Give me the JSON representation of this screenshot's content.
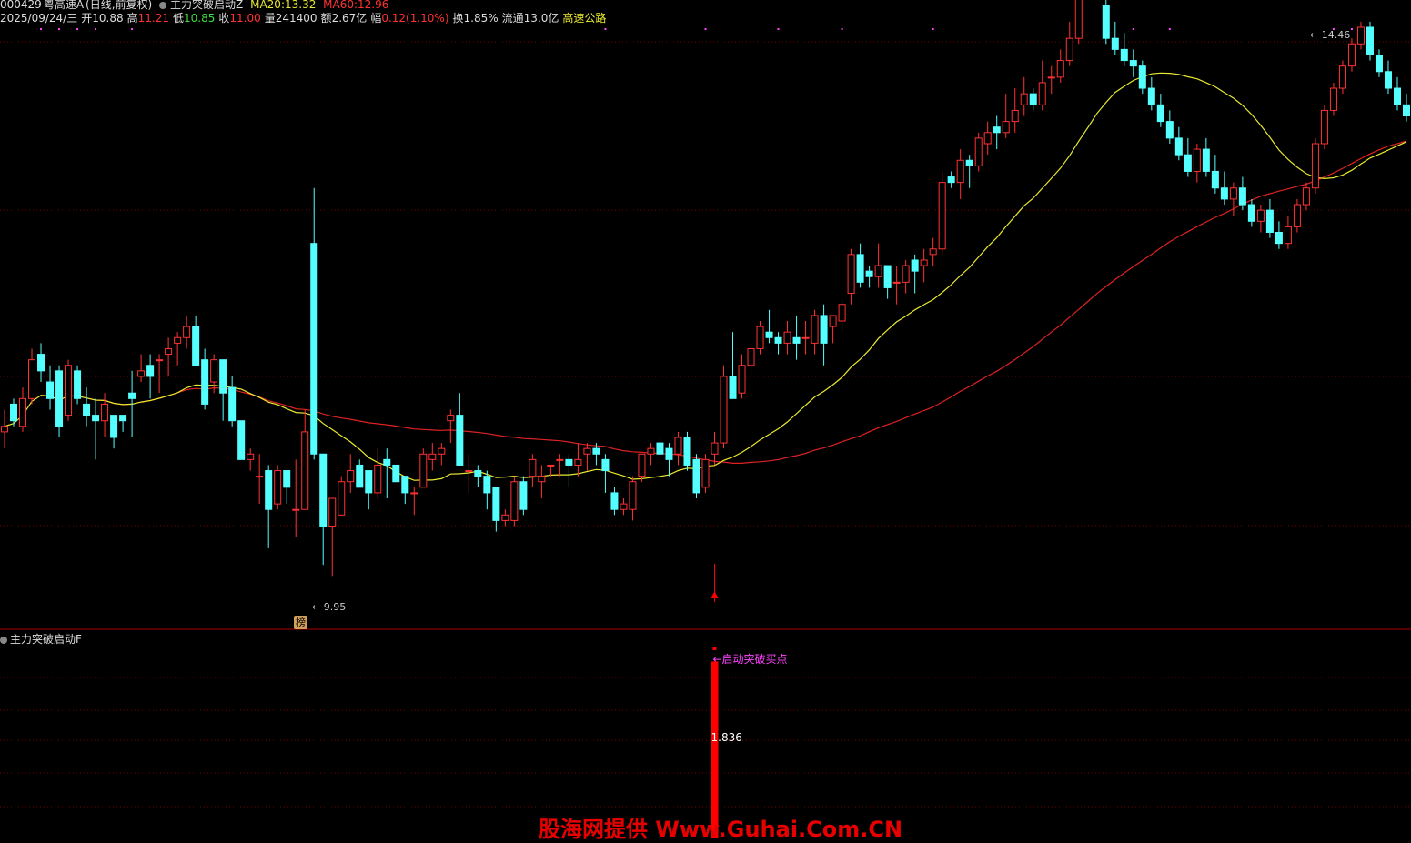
{
  "header": {
    "code": "000429",
    "name": "粤高速A",
    "period": "(日线,前复权)",
    "indicator_main": "主力突破启动Z",
    "ma20_label": "MA20:",
    "ma20_value": "13.32",
    "ma60_label": "MA60:",
    "ma60_value": "12.96",
    "date": "2025/09/24/三",
    "open_label": "开",
    "open": "10.88",
    "high_label": "高",
    "high": "11.21",
    "low_label": "低",
    "low": "10.85",
    "close_label": "收",
    "close": "11.00",
    "vol_label": "量",
    "vol": "241400",
    "amt_label": "额",
    "amt": "2.67亿",
    "chg_label": "幅",
    "chg": "0.12(1.10%)",
    "turnover_label": "换",
    "turnover": "1.85%",
    "float_label": "流通",
    "float_cap": "13.0亿",
    "sector": "高速公路"
  },
  "indicator_panel": {
    "title": "主力突破启动F",
    "signal_label": "←启动突破买点",
    "value_label": "1.836",
    "value": 1.836
  },
  "annotations": {
    "high_label": "14.46",
    "low_label": "9.95",
    "badge": "榜"
  },
  "watermark": "股海网提供 Www.Guhai.Com.CN",
  "colors": {
    "up": "#ff3232",
    "down": "#54ffff",
    "ma20": "#e8e832",
    "ma60": "#dd2222",
    "grid": "#7a0000",
    "signal": "#ff0000"
  },
  "chart_data": {
    "type": "candlestick",
    "price_range": [
      9.6,
      14.9
    ],
    "signal_index": 78,
    "candles": [
      [
        11.25,
        11.45,
        11.1,
        11.3
      ],
      [
        11.5,
        11.55,
        11.3,
        11.35
      ],
      [
        11.3,
        11.65,
        11.25,
        11.55
      ],
      [
        11.55,
        12.0,
        11.5,
        11.9
      ],
      [
        11.95,
        12.05,
        11.7,
        11.8
      ],
      [
        11.7,
        11.85,
        11.45,
        11.55
      ],
      [
        11.8,
        11.85,
        11.2,
        11.3
      ],
      [
        11.4,
        11.9,
        11.35,
        11.85
      ],
      [
        11.8,
        11.85,
        11.5,
        11.55
      ],
      [
        11.5,
        11.65,
        11.3,
        11.4
      ],
      [
        11.4,
        11.55,
        11.0,
        11.35
      ],
      [
        11.35,
        11.6,
        11.2,
        11.5
      ],
      [
        11.4,
        11.4,
        11.1,
        11.2
      ],
      [
        11.4,
        11.4,
        11.25,
        11.35
      ],
      [
        11.6,
        11.8,
        11.2,
        11.55
      ],
      [
        11.75,
        11.95,
        11.7,
        11.8
      ],
      [
        11.85,
        11.95,
        11.55,
        11.75
      ],
      [
        11.9,
        11.95,
        11.6,
        11.9
      ],
      [
        11.95,
        12.1,
        11.75,
        12.0
      ],
      [
        12.05,
        12.15,
        11.85,
        12.1
      ],
      [
        12.1,
        12.3,
        12.0,
        12.2
      ],
      [
        12.2,
        12.3,
        11.9,
        11.85
      ],
      [
        11.9,
        12.0,
        11.45,
        11.5
      ],
      [
        11.7,
        11.95,
        11.6,
        11.9
      ],
      [
        11.9,
        11.9,
        11.35,
        11.6
      ],
      [
        11.65,
        11.75,
        11.3,
        11.35
      ],
      [
        11.35,
        11.35,
        11.0,
        11.0
      ],
      [
        11.0,
        11.1,
        10.9,
        11.05
      ],
      [
        10.85,
        11.05,
        10.6,
        10.85
      ],
      [
        10.9,
        10.95,
        10.2,
        10.55
      ],
      [
        10.6,
        10.95,
        10.55,
        10.9
      ],
      [
        10.9,
        10.9,
        10.6,
        10.75
      ],
      [
        10.55,
        11.0,
        10.3,
        10.55
      ],
      [
        10.55,
        11.45,
        10.55,
        11.25
      ],
      [
        12.95,
        13.45,
        11.0,
        11.05
      ],
      [
        11.05,
        11.05,
        10.05,
        10.4
      ],
      [
        10.4,
        10.65,
        9.95,
        10.65
      ],
      [
        10.5,
        10.85,
        10.5,
        10.8
      ],
      [
        10.8,
        11.05,
        10.7,
        10.9
      ],
      [
        10.95,
        11.0,
        10.75,
        10.75
      ],
      [
        10.9,
        10.9,
        10.55,
        10.7
      ],
      [
        10.7,
        11.1,
        10.65,
        10.95
      ],
      [
        11.0,
        11.1,
        10.65,
        10.95
      ],
      [
        10.95,
        10.95,
        10.85,
        10.8
      ],
      [
        10.85,
        10.85,
        10.6,
        10.7
      ],
      [
        10.7,
        10.75,
        10.5,
        10.7
      ],
      [
        10.75,
        11.1,
        10.75,
        11.05
      ],
      [
        11.0,
        11.15,
        10.9,
        11.05
      ],
      [
        11.05,
        11.15,
        10.95,
        11.1
      ],
      [
        11.35,
        11.45,
        11.15,
        11.4
      ],
      [
        11.4,
        11.6,
        11.1,
        10.95
      ],
      [
        10.9,
        11.05,
        10.7,
        10.9
      ],
      [
        10.9,
        10.95,
        10.75,
        10.85
      ],
      [
        10.85,
        10.9,
        10.55,
        10.7
      ],
      [
        10.75,
        10.75,
        10.35,
        10.45
      ],
      [
        10.45,
        10.55,
        10.4,
        10.5
      ],
      [
        10.45,
        10.85,
        10.4,
        10.8
      ],
      [
        10.8,
        10.85,
        10.5,
        10.55
      ],
      [
        10.85,
        11.05,
        10.75,
        11.0
      ],
      [
        10.8,
        10.95,
        10.65,
        10.85
      ],
      [
        10.95,
        10.95,
        10.85,
        10.95
      ],
      [
        11.0,
        11.05,
        10.85,
        11.0
      ],
      [
        11.0,
        11.05,
        10.75,
        10.95
      ],
      [
        10.95,
        11.15,
        10.85,
        11.0
      ],
      [
        11.05,
        11.15,
        10.9,
        11.1
      ],
      [
        11.1,
        11.15,
        10.95,
        11.05
      ],
      [
        11.0,
        11.05,
        10.7,
        10.9
      ],
      [
        10.7,
        10.75,
        10.5,
        10.55
      ],
      [
        10.55,
        10.65,
        10.5,
        10.6
      ],
      [
        10.55,
        10.85,
        10.45,
        10.8
      ],
      [
        10.85,
        11.05,
        10.8,
        11.05
      ],
      [
        11.05,
        11.15,
        10.95,
        11.1
      ],
      [
        11.15,
        11.2,
        11.0,
        11.05
      ],
      [
        11.1,
        11.15,
        10.85,
        11.0
      ],
      [
        11.05,
        11.25,
        10.95,
        11.2
      ],
      [
        11.2,
        11.25,
        10.9,
        10.95
      ],
      [
        11.0,
        11.05,
        10.65,
        10.7
      ],
      [
        10.75,
        11.05,
        10.7,
        11.0
      ],
      [
        11.05,
        11.25,
        10.95,
        11.15
      ],
      [
        11.15,
        11.85,
        11.1,
        11.75
      ],
      [
        11.75,
        12.15,
        11.6,
        11.55
      ],
      [
        11.6,
        11.95,
        11.55,
        11.85
      ],
      [
        11.85,
        12.05,
        11.75,
        12.0
      ],
      [
        12.0,
        12.25,
        11.95,
        12.2
      ],
      [
        12.15,
        12.35,
        12.05,
        12.1
      ],
      [
        12.1,
        12.15,
        11.95,
        12.05
      ],
      [
        12.05,
        12.25,
        11.95,
        12.15
      ],
      [
        12.1,
        12.3,
        11.9,
        12.05
      ],
      [
        12.1,
        12.25,
        11.95,
        12.1
      ],
      [
        12.05,
        12.35,
        11.95,
        12.3
      ],
      [
        12.3,
        12.4,
        11.85,
        12.05
      ],
      [
        12.2,
        12.3,
        12.05,
        12.3
      ],
      [
        12.25,
        12.45,
        12.15,
        12.4
      ],
      [
        12.5,
        12.9,
        12.4,
        12.85
      ],
      [
        12.85,
        12.95,
        12.55,
        12.6
      ],
      [
        12.7,
        12.75,
        12.55,
        12.65
      ],
      [
        12.65,
        12.95,
        12.55,
        12.75
      ],
      [
        12.75,
        12.75,
        12.45,
        12.55
      ],
      [
        12.6,
        12.75,
        12.4,
        12.6
      ],
      [
        12.6,
        12.8,
        12.5,
        12.75
      ],
      [
        12.8,
        12.85,
        12.5,
        12.7
      ],
      [
        12.75,
        12.9,
        12.6,
        12.8
      ],
      [
        12.85,
        13.0,
        12.75,
        12.9
      ],
      [
        12.9,
        13.6,
        12.85,
        13.5
      ],
      [
        13.55,
        13.6,
        13.45,
        13.5
      ],
      [
        13.5,
        13.8,
        13.35,
        13.7
      ],
      [
        13.7,
        13.75,
        13.45,
        13.65
      ],
      [
        13.65,
        13.95,
        13.6,
        13.9
      ],
      [
        13.85,
        14.05,
        13.75,
        13.95
      ],
      [
        14.0,
        14.1,
        13.8,
        13.95
      ],
      [
        13.95,
        14.3,
        13.9,
        14.05
      ],
      [
        14.05,
        14.35,
        13.95,
        14.15
      ],
      [
        14.2,
        14.45,
        14.1,
        14.3
      ],
      [
        14.3,
        14.35,
        14.15,
        14.2
      ],
      [
        14.2,
        14.6,
        14.15,
        14.4
      ],
      [
        14.45,
        14.55,
        14.3,
        14.45
      ],
      [
        14.45,
        14.7,
        14.4,
        14.6
      ],
      [
        14.6,
        14.95,
        14.55,
        14.8
      ],
      [
        14.8,
        15.3,
        14.75,
        15.2
      ],
      [
        15.25,
        15.35,
        15.15,
        15.2
      ],
      [
        15.25,
        15.35,
        15.15,
        15.25
      ],
      [
        15.1,
        15.2,
        14.75,
        14.8
      ],
      [
        14.8,
        14.95,
        14.65,
        14.7
      ],
      [
        14.7,
        14.85,
        14.55,
        14.6
      ],
      [
        14.6,
        14.7,
        14.45,
        14.55
      ],
      [
        14.55,
        14.6,
        14.3,
        14.35
      ],
      [
        14.35,
        14.45,
        14.15,
        14.2
      ],
      [
        14.2,
        14.3,
        14.0,
        14.05
      ],
      [
        14.05,
        14.15,
        13.85,
        13.9
      ],
      [
        13.9,
        14.0,
        13.7,
        13.75
      ],
      [
        13.75,
        13.9,
        13.55,
        13.6
      ],
      [
        13.6,
        13.85,
        13.5,
        13.8
      ],
      [
        13.8,
        13.9,
        13.55,
        13.6
      ],
      [
        13.6,
        13.75,
        13.4,
        13.45
      ],
      [
        13.45,
        13.6,
        13.3,
        13.35
      ],
      [
        13.35,
        13.5,
        13.2,
        13.45
      ],
      [
        13.45,
        13.55,
        13.25,
        13.3
      ],
      [
        13.3,
        13.35,
        13.1,
        13.15
      ],
      [
        13.15,
        13.3,
        13.05,
        13.25
      ],
      [
        13.25,
        13.35,
        13.0,
        13.05
      ],
      [
        13.05,
        13.15,
        12.9,
        12.95
      ],
      [
        12.95,
        13.2,
        12.9,
        13.1
      ],
      [
        13.1,
        13.35,
        13.05,
        13.3
      ],
      [
        13.3,
        13.5,
        13.25,
        13.45
      ],
      [
        13.45,
        13.9,
        13.4,
        13.85
      ],
      [
        13.85,
        14.2,
        13.8,
        14.15
      ],
      [
        14.15,
        14.4,
        14.1,
        14.35
      ],
      [
        14.35,
        14.6,
        14.3,
        14.55
      ],
      [
        14.55,
        14.8,
        14.5,
        14.75
      ],
      [
        14.75,
        14.95,
        14.7,
        14.9
      ],
      [
        14.9,
        14.95,
        14.6,
        14.65
      ],
      [
        14.65,
        14.7,
        14.45,
        14.5
      ],
      [
        14.5,
        14.6,
        14.3,
        14.35
      ],
      [
        14.35,
        14.45,
        14.15,
        14.2
      ],
      [
        14.2,
        14.3,
        14.05,
        14.1
      ]
    ]
  }
}
